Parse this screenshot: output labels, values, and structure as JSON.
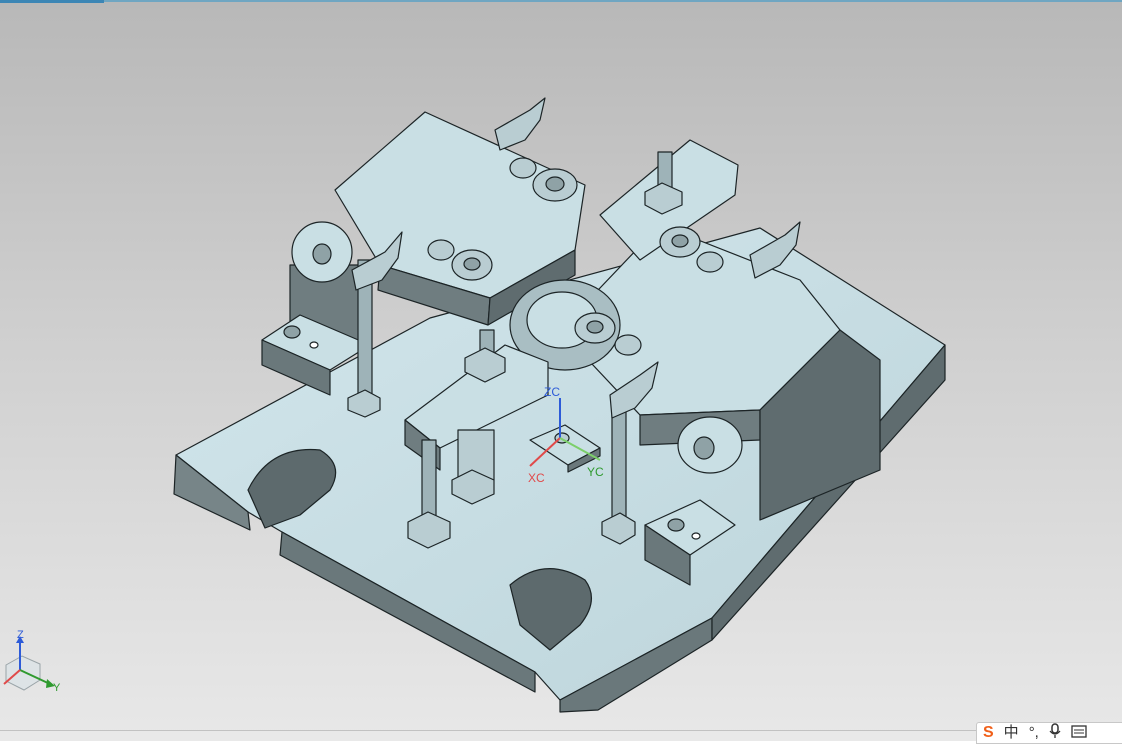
{
  "viewport": {
    "work_csys": {
      "x_label": "XC",
      "y_label": "YC",
      "z_label": "ZC"
    },
    "view_triad": {
      "y_label": "Y",
      "z_label": "Z"
    }
  },
  "ime_toolbar": {
    "logo": "S",
    "mode": "中",
    "punct": "°,",
    "mic_icon": "microphone-icon",
    "keyboard_icon": "keyboard-icon"
  },
  "colors": {
    "part_face": "#c6dde3",
    "part_side": "#6f7d80",
    "edge": "#1c2426",
    "x_axis": "#e04a4a",
    "y_axis": "#2f9a2f",
    "z_axis": "#2d5bd8"
  }
}
